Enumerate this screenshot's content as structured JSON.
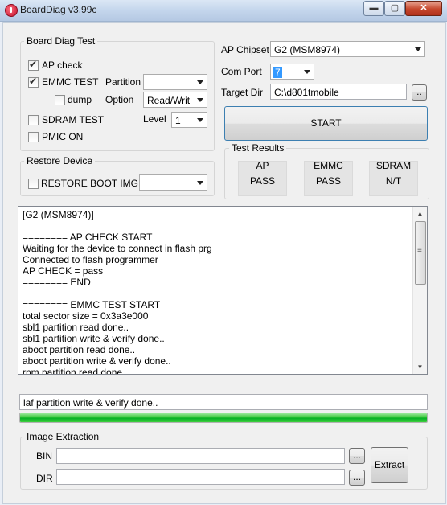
{
  "window": {
    "title": "BoardDiag v3.99c",
    "controls": {
      "minimize": "▬",
      "maximize": "▢",
      "close": "✕"
    }
  },
  "board_diag": {
    "group_title": "Board Diag Test",
    "ap_check": {
      "label": "AP check",
      "checked": true
    },
    "emmc_test": {
      "label": "EMMC TEST",
      "checked": true
    },
    "partition": {
      "label": "Partition",
      "value": ""
    },
    "dump": {
      "label": "dump",
      "checked": false
    },
    "option": {
      "label": "Option",
      "value": "Read/Writ"
    },
    "sdram_test": {
      "label": "SDRAM TEST",
      "checked": false
    },
    "level": {
      "label": "Level",
      "value": "1"
    },
    "pmic_on": {
      "label": "PMIC ON",
      "checked": false
    }
  },
  "restore_device": {
    "group_title": "Restore Device",
    "restore_boot_img": {
      "label": "RESTORE BOOT IMG",
      "checked": false,
      "value": ""
    }
  },
  "settings": {
    "ap_chipset": {
      "label": "AP Chipset",
      "value": "G2 (MSM8974)"
    },
    "com_port": {
      "label": "Com Port",
      "value": "7"
    },
    "target_dir": {
      "label": "Target Dir",
      "value": "C:\\d801tmobile",
      "browse_label": ".."
    },
    "start_label": "START"
  },
  "test_results": {
    "group_title": "Test Results",
    "items": [
      {
        "name": "AP",
        "value": "PASS"
      },
      {
        "name": "EMMC",
        "value": "PASS"
      },
      {
        "name": "SDRAM",
        "value": "N/T"
      }
    ]
  },
  "log": {
    "lines": [
      "[G2 (MSM8974)]",
      "",
      "======== AP CHECK START",
      "Waiting for the device to connect in flash prg",
      "Connected to flash programmer",
      "AP CHECK = pass",
      "======== END",
      "",
      "======== EMMC TEST START",
      "total sector size = 0x3a3e000",
      "sbl1 partition read done..",
      "sbl1 partition write & verify done..",
      "aboot partition read done..",
      "aboot partition write & verify done..",
      "rpm partition read done.."
    ],
    "scroll_up": "▲",
    "scroll_down": "▼",
    "thumb_grip": "≡"
  },
  "status": {
    "text": "laf partition write & verify done..",
    "progress": 1.0
  },
  "image_extraction": {
    "group_title": "Image Extraction",
    "bin": {
      "label": "BIN",
      "value": "",
      "browse_label": "..."
    },
    "dir": {
      "label": "DIR",
      "value": "",
      "browse_label": "..."
    },
    "extract_label": "Extract"
  },
  "colors": {
    "progress_green": "#06b025",
    "window_bg": "#f0f0f0"
  }
}
